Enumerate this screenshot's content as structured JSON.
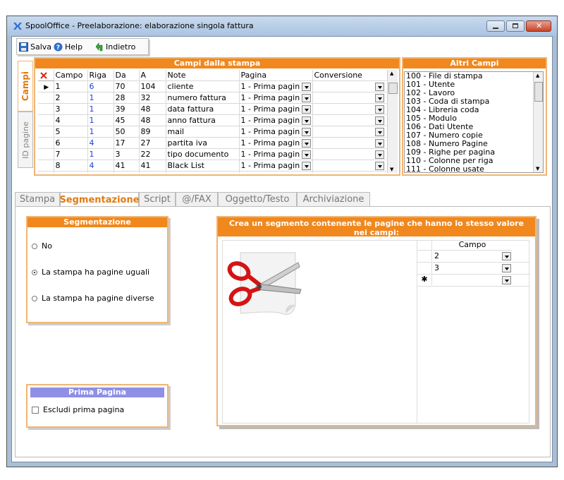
{
  "window": {
    "title": "SpoolOffice - Preelaborazione: elaborazione singola fattura"
  },
  "toolbar": {
    "save_label": "Salva",
    "help_label": "Help",
    "back_label": "Indietro"
  },
  "side_tabs": {
    "campi": "Campi",
    "id_pagine": "ID pagine"
  },
  "campi_stampa": {
    "title": "Campi dalla stampa",
    "columns": [
      "Campo",
      "Riga",
      "Da",
      "A",
      "Note",
      "Pagina",
      "Conversione"
    ],
    "rows": [
      {
        "campo": "1",
        "riga": "6",
        "da": "70",
        "a": "104",
        "note": "cliente",
        "pagina": "1 - Prima pagin",
        "conversione": ""
      },
      {
        "campo": "2",
        "riga": "1",
        "da": "28",
        "a": "32",
        "note": "numero fattura",
        "pagina": "1 - Prima pagin",
        "conversione": ""
      },
      {
        "campo": "3",
        "riga": "1",
        "da": "39",
        "a": "48",
        "note": "data fattura",
        "pagina": "1 - Prima pagin",
        "conversione": ""
      },
      {
        "campo": "4",
        "riga": "1",
        "da": "45",
        "a": "48",
        "note": "anno fattura",
        "pagina": "1 - Prima pagin",
        "conversione": ""
      },
      {
        "campo": "5",
        "riga": "1",
        "da": "50",
        "a": "89",
        "note": "mail",
        "pagina": "1 - Prima pagin",
        "conversione": ""
      },
      {
        "campo": "6",
        "riga": "4",
        "da": "17",
        "a": "27",
        "note": "partita iva",
        "pagina": "1 - Prima pagin",
        "conversione": ""
      },
      {
        "campo": "7",
        "riga": "1",
        "da": "3",
        "a": "22",
        "note": "tipo documento",
        "pagina": "1 - Prima pagin",
        "conversione": ""
      },
      {
        "campo": "8",
        "riga": "4",
        "da": "41",
        "a": "41",
        "note": "Black List",
        "pagina": "1 - Prima pagin",
        "conversione": ""
      }
    ]
  },
  "altri_campi": {
    "title": "Altri Campi",
    "items": [
      "100 - File di stampa",
      "101 - Utente",
      "102 - Lavoro",
      "103 - Coda di stampa",
      "104 - Libreria coda",
      "105 - Modulo",
      "106 - Dati Utente",
      "107 - Numero copie",
      "108 - Numero Pagine",
      "109 - Righe per pagina",
      "110 - Colonne per riga",
      "111 - Colonne usate"
    ]
  },
  "tabs": [
    "Stampa",
    "Segmentazione",
    "Script",
    "@/FAX",
    "Oggetto/Testo",
    "Archiviazione"
  ],
  "active_tab": "Segmentazione",
  "segmentazione": {
    "title": "Segmentazione",
    "options": [
      "No",
      "La stampa ha pagine uguali",
      "La stampa ha pagine diverse"
    ],
    "selected": "La stampa ha pagine uguali"
  },
  "prima_pagina": {
    "title": "Prima Pagina",
    "checkbox_label": "Escludi prima pagina",
    "checked": false
  },
  "segmento": {
    "title": "Crea un segmento contenente le pagine che hanno lo stesso valore nei campi:",
    "column": "Campo",
    "values": [
      "2",
      "3"
    ],
    "new_row_marker": "✱"
  },
  "colors": {
    "accent": "#f0881e",
    "frame": "#f0b574",
    "purple": "#8f8fe6",
    "link_blue": "#1b3fcf"
  }
}
